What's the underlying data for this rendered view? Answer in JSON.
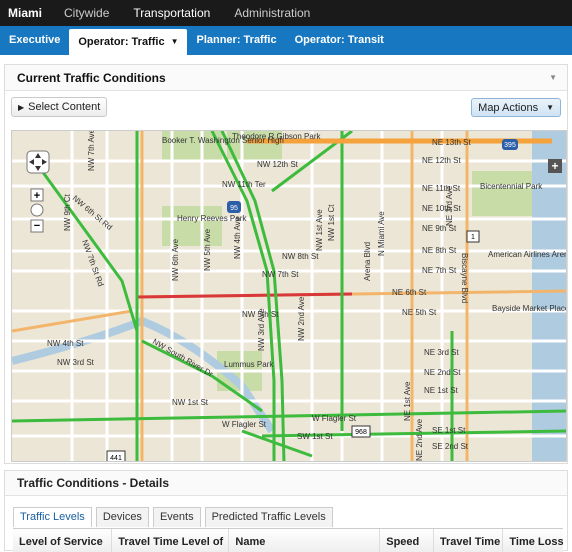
{
  "topbar": {
    "brand": "Miami",
    "items": [
      "Citywide",
      "Transportation",
      "Administration"
    ]
  },
  "subnav": {
    "tabs": [
      "Executive",
      "Operator: Traffic",
      "Planner: Traffic",
      "Operator: Transit"
    ]
  },
  "conditions": {
    "title": "Current Traffic Conditions",
    "select_content": "Select Content",
    "map_actions": "Map Actions"
  },
  "map": {
    "labels": [
      "Booker T. Washington Senior High",
      "Theodore R Gibson Park",
      "Henry Reeves Park",
      "Lummus Park",
      "Bicentennial Park",
      "American Airlines Arena",
      "Bayside Market Place",
      "NW 12th St",
      "NW 11th Ter",
      "NW 8th St",
      "NW 7th St",
      "NW 5th St",
      "NW 4th St",
      "NW 3rd St",
      "NW 1st St",
      "W Flagler St",
      "SW 1st St",
      "NE 13th St",
      "NE 12th St",
      "NE 11th St",
      "NE 10th St",
      "NE 9th St",
      "NE 8th St",
      "NE 7th St",
      "NE 6th St",
      "NE 5th St",
      "NE 3rd St",
      "NE 2nd St",
      "NE 1st St",
      "SE 1st St",
      "SE 2nd St",
      "Biscayne Blvd",
      "N Miami Ave",
      "NW 1st Ave",
      "NW 2nd Ave",
      "NW 3rd Ave",
      "NW 4th Ave",
      "NW 5th Ave",
      "NW 6th Ave",
      "NW 7th Ave",
      "NW 9th Ct",
      "NW 7th St Rd",
      "NW 6th St Rd",
      "NW South River Dr",
      "NW 1st Ct",
      "Arena Blvd",
      "NE 1st Ave",
      "NE 2nd Ave",
      "NE 3rd Ave",
      "W Flagler St"
    ],
    "shields": [
      "95",
      "395",
      "1",
      "441",
      "968"
    ]
  },
  "details": {
    "title": "Traffic Conditions - Details",
    "tabs": [
      "Traffic Levels",
      "Devices",
      "Events",
      "Predicted Traffic Levels"
    ],
    "columns": [
      "Level of Service",
      "Travel Time Level of",
      "Name",
      "Speed",
      "Travel Time",
      "Time Loss"
    ]
  }
}
